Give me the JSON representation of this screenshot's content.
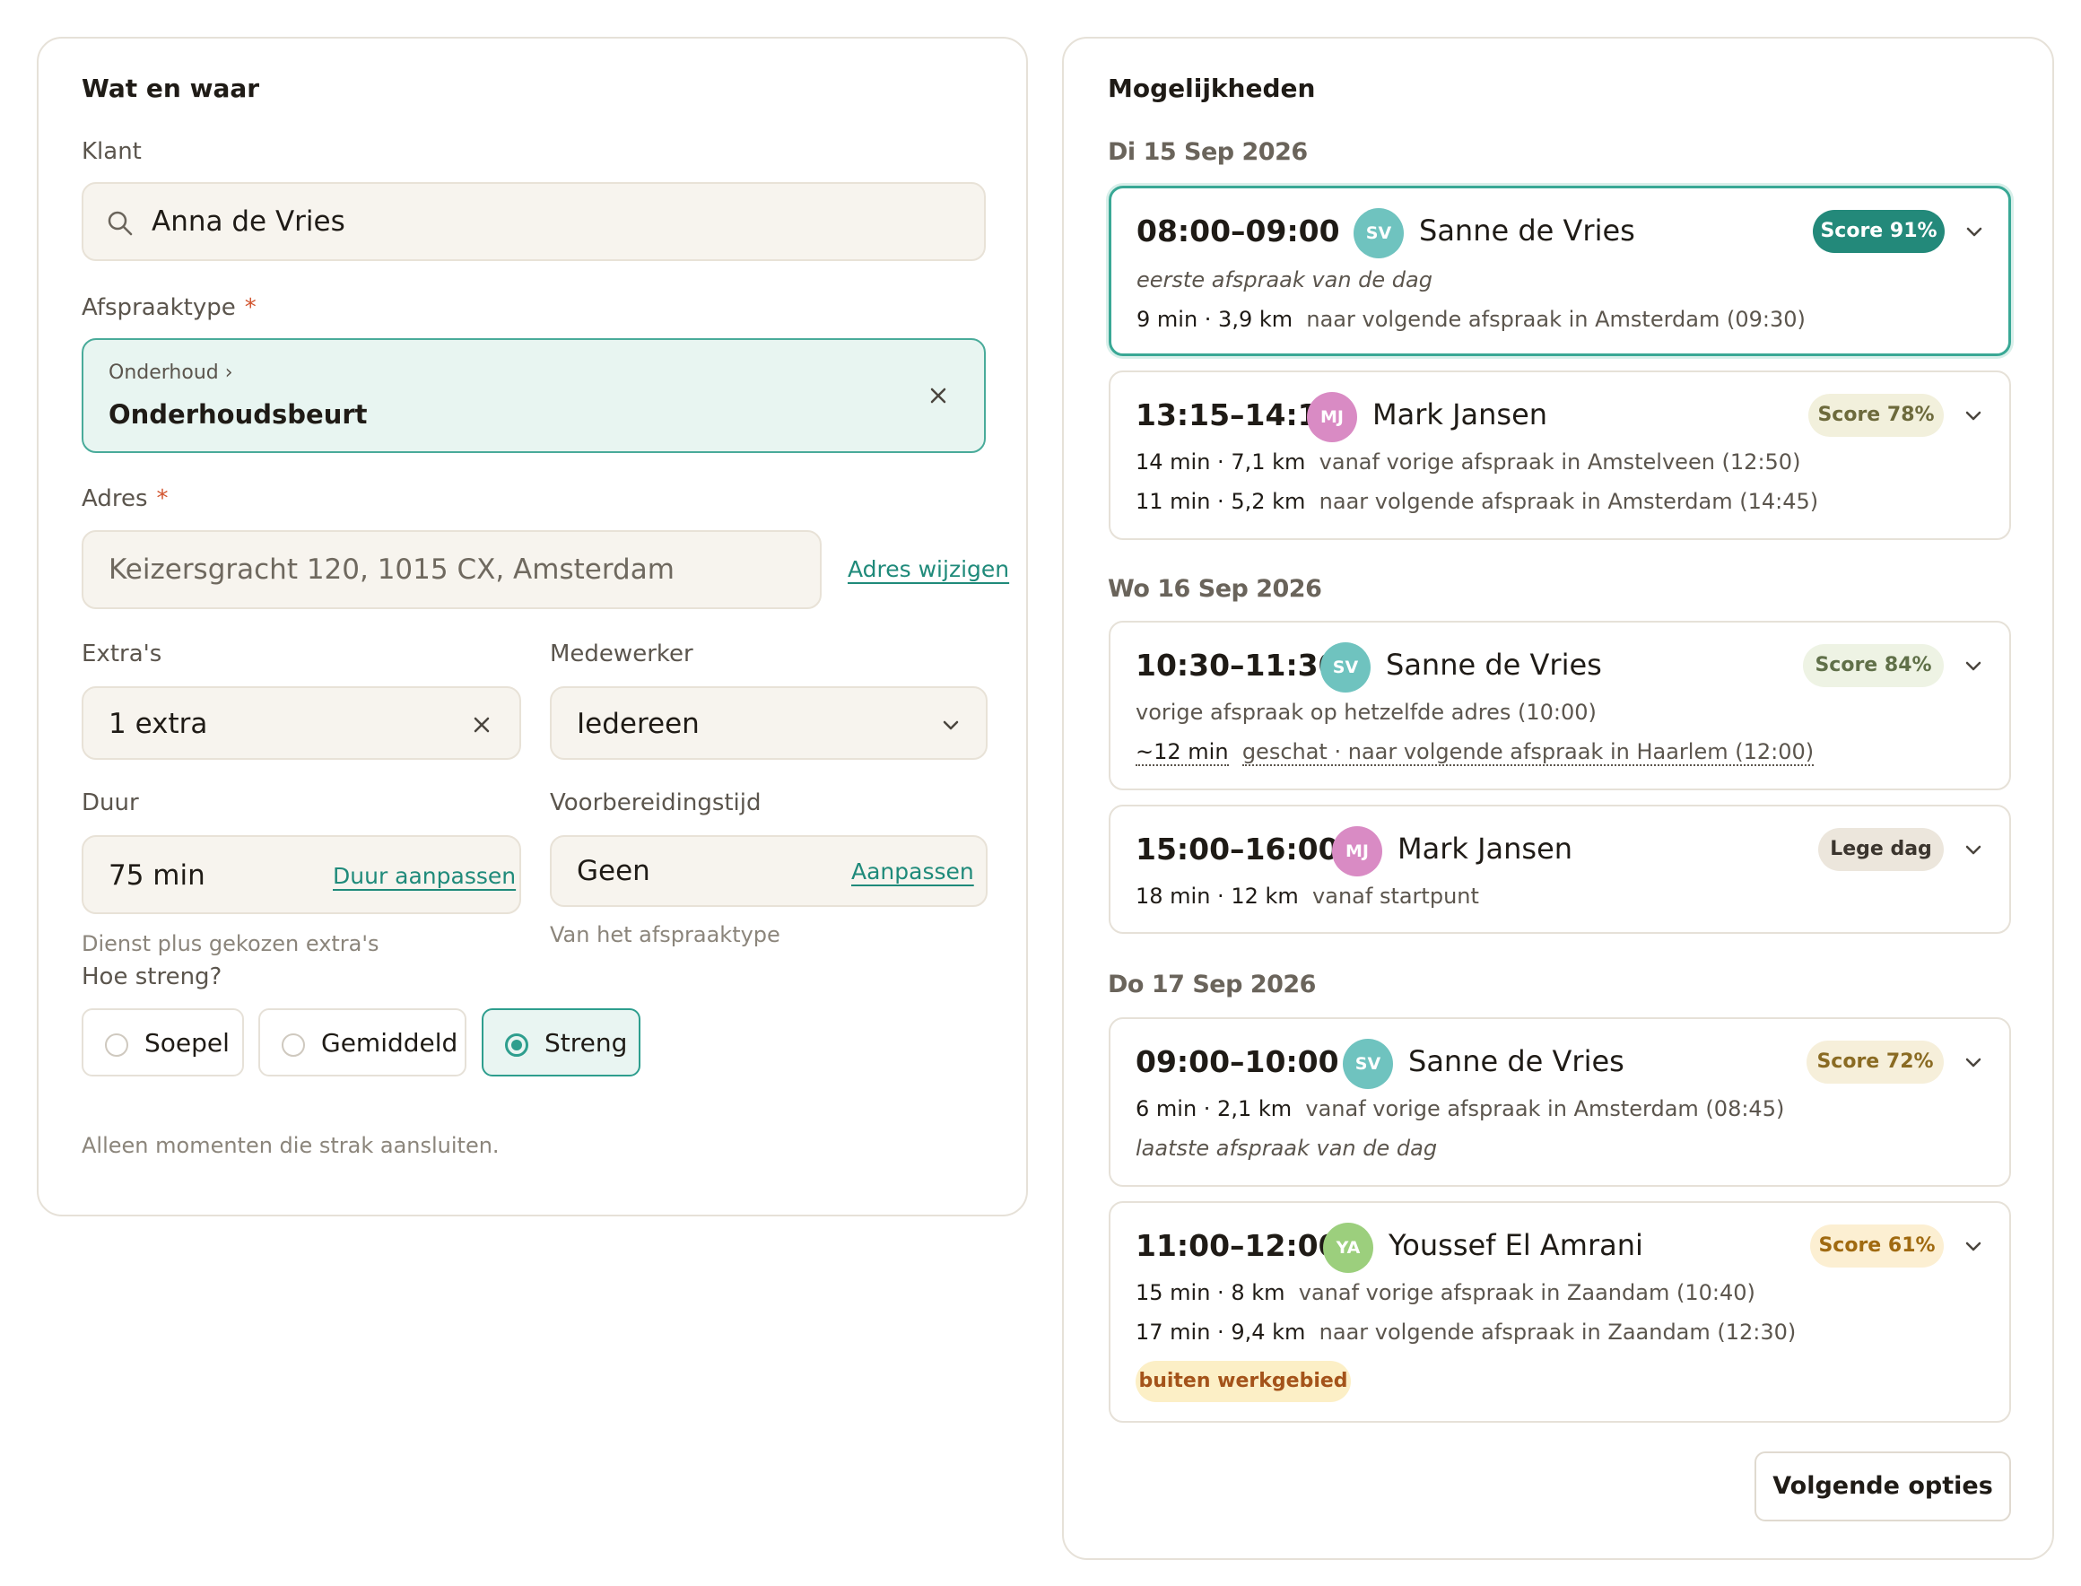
{
  "left": {
    "title": "Wat en waar",
    "klant": {
      "label": "Klant",
      "value": "Anna de Vries"
    },
    "afspraaktype": {
      "label": "Afspraaktype",
      "required": "*",
      "category": "Onderhoud ›",
      "value": "Onderhoudsbeurt"
    },
    "adres": {
      "label": "Adres",
      "required": "*",
      "value": "Keizersgracht 120, 1015 CX, Amsterdam",
      "change_link": "Adres wijzigen"
    },
    "extras": {
      "label": "Extra's",
      "value": "1 extra"
    },
    "medewerker": {
      "label": "Medewerker",
      "value": "Iedereen"
    },
    "duur": {
      "label": "Duur",
      "value": "75 min",
      "link": "Duur aanpassen",
      "hint": "Dienst plus gekozen extra's"
    },
    "voorbereiding": {
      "label": "Voorbereidingstijd",
      "value": "Geen",
      "link": "Aanpassen",
      "hint": "Van het afspraaktype"
    },
    "strictness": {
      "label": "Hoe streng?",
      "options": [
        "Soepel",
        "Gemiddeld",
        "Streng"
      ],
      "selected": "Streng",
      "hint": "Alleen momenten die strak aansluiten."
    }
  },
  "right": {
    "title": "Mogelijkheden",
    "days": [
      {
        "label": "Di 15 Sep 2026"
      },
      {
        "label": "Wo 16 Sep 2026"
      },
      {
        "label": "Do 17 Sep 2026"
      }
    ],
    "slots": [
      {
        "time": "08:00–09:00",
        "initials": "SV",
        "name": "Sanne de Vries",
        "badge": "Score 91%",
        "l1": "eerste afspraak van de dag",
        "l2_strong": "9 min · 3,9 km",
        "l2": "naar volgende afspraak in Amsterdam (09:30)"
      },
      {
        "time": "13:15–14:15",
        "initials": "MJ",
        "name": "Mark Jansen",
        "badge": "Score 78%",
        "l1_strong": "14 min · 7,1 km",
        "l1": "vanaf vorige afspraak in Amstelveen (12:50)",
        "l2_strong": "11 min · 5,2 km",
        "l2": "naar volgende afspraak in Amsterdam (14:45)"
      },
      {
        "time": "10:30–11:30",
        "initials": "SV",
        "name": "Sanne de Vries",
        "badge": "Score 84%",
        "l1": "vorige afspraak op hetzelfde adres (10:00)",
        "l2_strong": "~12 min",
        "l2": "geschat · naar volgende afspraak in Haarlem (12:00)"
      },
      {
        "time": "15:00–16:00",
        "initials": "MJ",
        "name": "Mark Jansen",
        "badge": "Lege dag",
        "l1_strong": "18 min · 12 km",
        "l1": "vanaf startpunt"
      },
      {
        "time": "09:00–10:00",
        "initials": "SV",
        "name": "Sanne de Vries",
        "badge": "Score 72%",
        "l1_strong": "6 min · 2,1 km",
        "l1": "vanaf vorige afspraak in Amsterdam (08:45)",
        "l2": "laatste afspraak van de dag"
      },
      {
        "time": "11:00–12:00",
        "initials": "YA",
        "name": "Youssef El Amrani",
        "badge": "Score 61%",
        "l1_strong": "15 min · 8 km",
        "l1": "vanaf vorige afspraak in Zaandam (10:40)",
        "l2_strong": "17 min · 9,4 km",
        "l2": "naar volgende afspraak in Zaandam (12:30)",
        "warning": "buiten werkgebied"
      }
    ],
    "next_button": "Volgende opties"
  },
  "colors": {
    "accent": "#2e9e8e",
    "avatar_sv": "#6fc3bf",
    "avatar_mj": "#d98bc4",
    "avatar_ya": "#9ccf7d",
    "badge_top": "#23897a",
    "badge_mid": "#f2f0dc",
    "badge_warm": "#fcefd2",
    "warning_bg": "#fcefc6"
  }
}
